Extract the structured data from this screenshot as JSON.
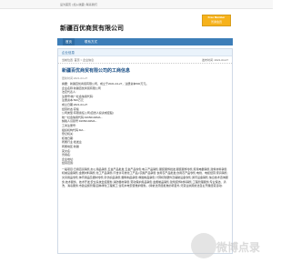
{
  "topbar": {
    "links": "设为首页 | 加入收藏 | 联系我们"
  },
  "header": {
    "title": "新疆百优商贸有限公司",
    "badge_line1": "Free Member",
    "badge_line2": "普通会员"
  },
  "nav": {
    "items": [
      {
        "label": "首页"
      },
      {
        "label": "联系方式"
      }
    ]
  },
  "panel": {
    "section_label": "企业信息",
    "breadcrumb": "当前位置: 首页 > 企业信息",
    "date_right": "发布时间: 2021-04-27",
    "article_title": "新疆百优商贸有限公司的工商信息",
    "meta": "更新时间:2021-04-27",
    "lines": [
      "摘要：新疆百优商贸有限公司，成立于2021-04-27，注册资本500万元。",
      "企业名称:新疆百优商贸有限公司",
      "法定代表人:",
      "注册号/统一社会信用代码:",
      "注册资本:500万元",
      "成立日期:2021-04-27",
      "经营状态:存续",
      "公司类型:有限责任公司(自然人投资或控股)",
      "统一社会信用代码:91650102MA...",
      "纳税人识别号:91650102MA...",
      "工商注册号:",
      "组织机构代码:MA...",
      "登记机关:",
      "核准日期:",
      "所属行业:批发业",
      "所属地区:新疆",
      "英文名:",
      "曾用名:",
      "企业地址:",
      "经营范围:"
    ],
    "scope": "一般项目:日用百货销售;办公用品销售;五金产品批发;五金产品零售;电子产品销售;服装服饰批发;服装服饰零售;家用电器销售;建筑材料销售;机械设备销售;金属材料销售;化工产品销售(不含许可类化工产品);农副产品销售;食用农产品批发;食用农产品零售;电线、电缆经营;家具销售;文具用品零售;体育用品及器材零售;针纺织品销售;塑料制品销售;橡胶制品销售;计算机软硬件及辅助设备零售;通讯设备销售;信息技术咨询服务;技术服务、技术开发;安全系统监控服务;消防器材销售;劳动保护用品销售;金属制品销售;建筑装饰材料销售;工程管理服务;专业保洁、清洗、消毒服务;市政设施管理;园林绿化工程施工;住宅水电安装维护服务。(除依法须经批准的项目外,凭营业执照依法自主开展经营活动)"
  },
  "watermark": {
    "text": "微博点录"
  }
}
